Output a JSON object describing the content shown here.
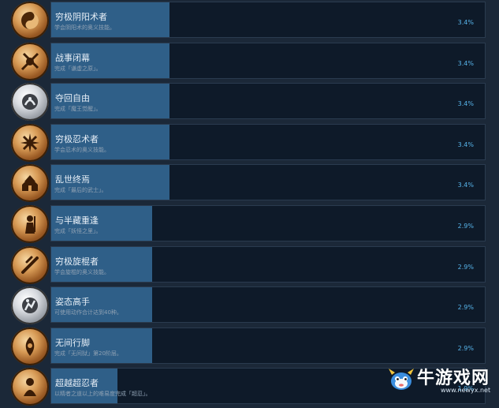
{
  "achievements": [
    {
      "title": "穷极阴阳术者",
      "desc": "学会阴阳术的奥义技能。",
      "pct": "3.4%",
      "pct_value": 3.4,
      "medal": "bronze",
      "icon": "yin-yang-icon"
    },
    {
      "title": "战事闭幕",
      "desc": "完成「谦虚之原」。",
      "pct": "3.4%",
      "pct_value": 3.4,
      "medal": "bronze",
      "icon": "battle-icon"
    },
    {
      "title": "夺回自由",
      "desc": "完成「魔王觉醒」。",
      "pct": "3.4%",
      "pct_value": 3.4,
      "medal": "silver",
      "icon": "freedom-icon"
    },
    {
      "title": "穷极忍术者",
      "desc": "学会忍术的奥义技能。",
      "pct": "3.4%",
      "pct_value": 3.4,
      "medal": "bronze",
      "icon": "ninja-icon"
    },
    {
      "title": "乱世终焉",
      "desc": "完成「最后的武士」。",
      "pct": "3.4%",
      "pct_value": 3.4,
      "medal": "bronze",
      "icon": "castle-icon"
    },
    {
      "title": "与半藏重逢",
      "desc": "完成「妖怪之里」。",
      "pct": "2.9%",
      "pct_value": 2.9,
      "medal": "bronze",
      "icon": "warrior-icon"
    },
    {
      "title": "穷极旋棍者",
      "desc": "学会旋棍的奥义技能。",
      "pct": "2.9%",
      "pct_value": 2.9,
      "medal": "bronze",
      "icon": "tonfa-icon"
    },
    {
      "title": "姿态高手",
      "desc": "可使用动作合计达到40种。",
      "pct": "2.9%",
      "pct_value": 2.9,
      "medal": "silver",
      "icon": "stance-icon"
    },
    {
      "title": "无间行脚",
      "desc": "完成「无间狱」第20阶层。",
      "pct": "2.9%",
      "pct_value": 2.9,
      "medal": "bronze",
      "icon": "pilgrim-icon"
    },
    {
      "title": "超越超忍者",
      "desc": "以精者之道以上的难易度完成「超忍」。",
      "pct": "1.9%",
      "pct_value": 1.9,
      "medal": "bronze",
      "icon": "monk-icon"
    }
  ],
  "watermark": {
    "name": "牛游戏网",
    "url": "www.newyx.net"
  }
}
